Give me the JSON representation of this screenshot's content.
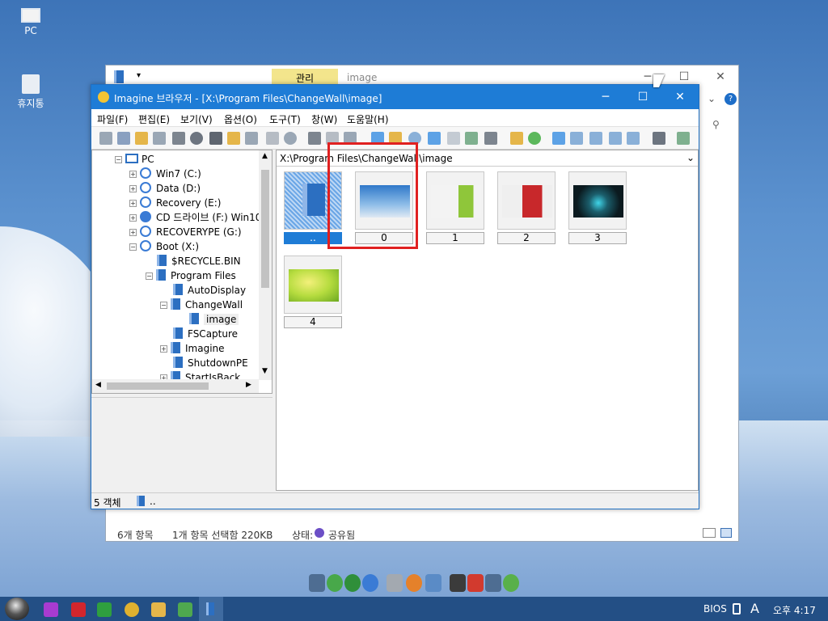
{
  "desktop": {
    "pc_label": "PC",
    "recycle_label": "휴지통"
  },
  "explorer": {
    "manage_tab": "관리",
    "title_path": "image",
    "status_count": "6개 항목",
    "status_selected": "1개 항목 선택함 220KB",
    "status_state": "상태:",
    "status_shared": "공유됨"
  },
  "imagine": {
    "title": "Imagine 브라우저 - [X:\\Program Files\\ChangeWall\\image]",
    "menu": [
      "파일(F)",
      "편집(E)",
      "보기(V)",
      "옵션(O)",
      "도구(T)",
      "창(W)",
      "도움말(H)"
    ],
    "tree": {
      "root": "PC",
      "drives": [
        "Win7 (C:)",
        "Data (D:)",
        "Recovery (E:)",
        "CD 드라이브 (F:) Win10",
        "RECOVERYPE (G:)",
        "Boot (X:)"
      ],
      "boot_children": [
        "$RECYCLE.BIN",
        "Program Files"
      ],
      "pf_children": [
        "AutoDisplay",
        "ChangeWall",
        "image",
        "FSCapture",
        "Imagine",
        "ShutdownPE",
        "StartIsBack"
      ]
    },
    "path": "X:\\Program Files\\ChangeWall\\image",
    "thumbnails": [
      {
        "label": "..",
        "kind": "folder"
      },
      {
        "label": "0",
        "kind": "blue-room"
      },
      {
        "label": "1",
        "kind": "green-room"
      },
      {
        "label": "2",
        "kind": "red-room"
      },
      {
        "label": "3",
        "kind": "dark-bike"
      },
      {
        "label": "4",
        "kind": "yellow-green"
      }
    ],
    "status_count": "5 객체",
    "status_folder": ".."
  },
  "taskbar": {
    "bios": "BIOS",
    "ime": "A",
    "clock": "오후 4:17"
  },
  "colors": {
    "titlebar": "#1e7cd6",
    "highlight_box": "#e02020",
    "taskbar": "#234f85"
  }
}
